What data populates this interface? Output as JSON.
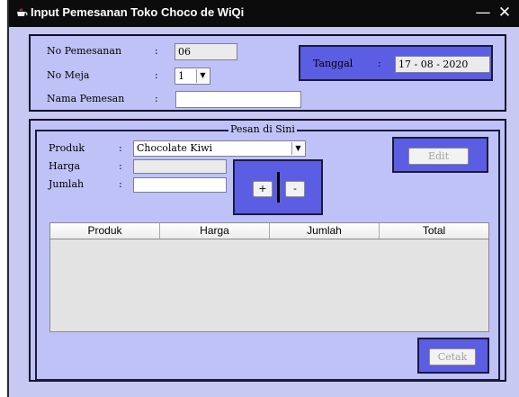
{
  "window": {
    "title": "Input Pemesanan Toko Choco de WiQi",
    "minimize_glyph": "—",
    "close_glyph": "✕"
  },
  "header": {
    "no_pemesanan_label": "No Pemesanan",
    "no_pemesanan_value": "06",
    "no_meja_label": "No Meja",
    "no_meja_value": "1",
    "nama_pemesan_label": "Nama Pemesan",
    "nama_pemesan_value": "",
    "colon": ":",
    "tanggal_label": "Tanggal",
    "tanggal_value": "17 - 08 - 2020"
  },
  "order": {
    "group_title": "Pesan di Sini",
    "produk_label": "Produk",
    "produk_value": "Chocolate Kiwi",
    "harga_label": "Harga",
    "harga_value": "",
    "jumlah_label": "Jumlah",
    "jumlah_value": "",
    "plus_label": "+",
    "minus_label": "-",
    "edit_label": "Edit",
    "cetak_label": "Cetak",
    "table_columns": [
      "Produk",
      "Harga",
      "Jumlah",
      "Total"
    ]
  },
  "icons": {
    "title_icon": "java-cup-icon",
    "dropdown_icon": "chevron-down-icon"
  },
  "colors": {
    "titlebar": "#0c0c0c",
    "panel": "#bfc2f6",
    "accent_box": "#5b5de3"
  }
}
